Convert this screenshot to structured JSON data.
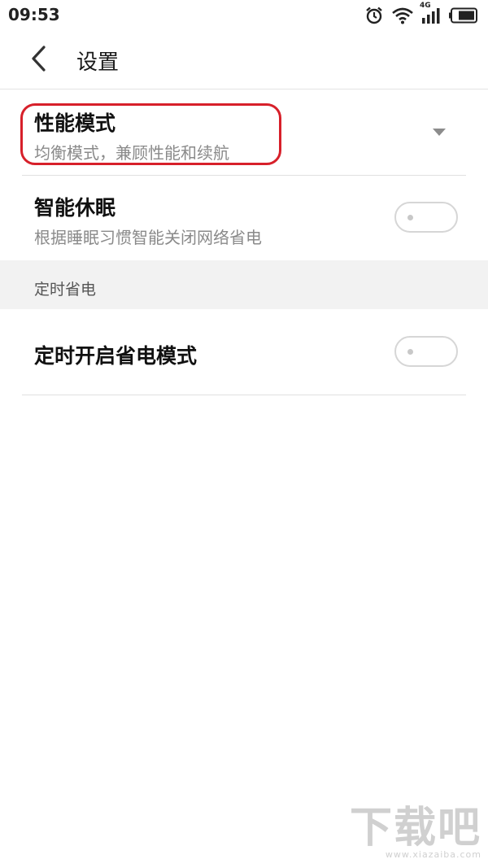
{
  "status_bar": {
    "time": "09:53",
    "network_label": "4G",
    "icons": [
      "alarm-icon",
      "wifi-icon",
      "cellular-signal-icon",
      "battery-icon"
    ]
  },
  "toolbar": {
    "back_icon": "chevron-left-icon",
    "title": "设置"
  },
  "settings": [
    {
      "title": "性能模式",
      "subtitle": "均衡模式，兼顾性能和续航",
      "control": "dropdown",
      "highlighted": true
    },
    {
      "title": "智能休眠",
      "subtitle": "根据睡眠习惯智能关闭网络省电",
      "control": "toggle",
      "checked": false
    }
  ],
  "section": {
    "header": "定时省电",
    "items": [
      {
        "title": "定时开启省电模式",
        "control": "toggle",
        "checked": false
      }
    ]
  },
  "colors": {
    "highlight": "#d7202a",
    "section_bg": "#f2f2f2",
    "subtitle": "#8a8a8a"
  },
  "watermark": {
    "text": "下载吧",
    "url": "www.xiazaiba.com"
  }
}
